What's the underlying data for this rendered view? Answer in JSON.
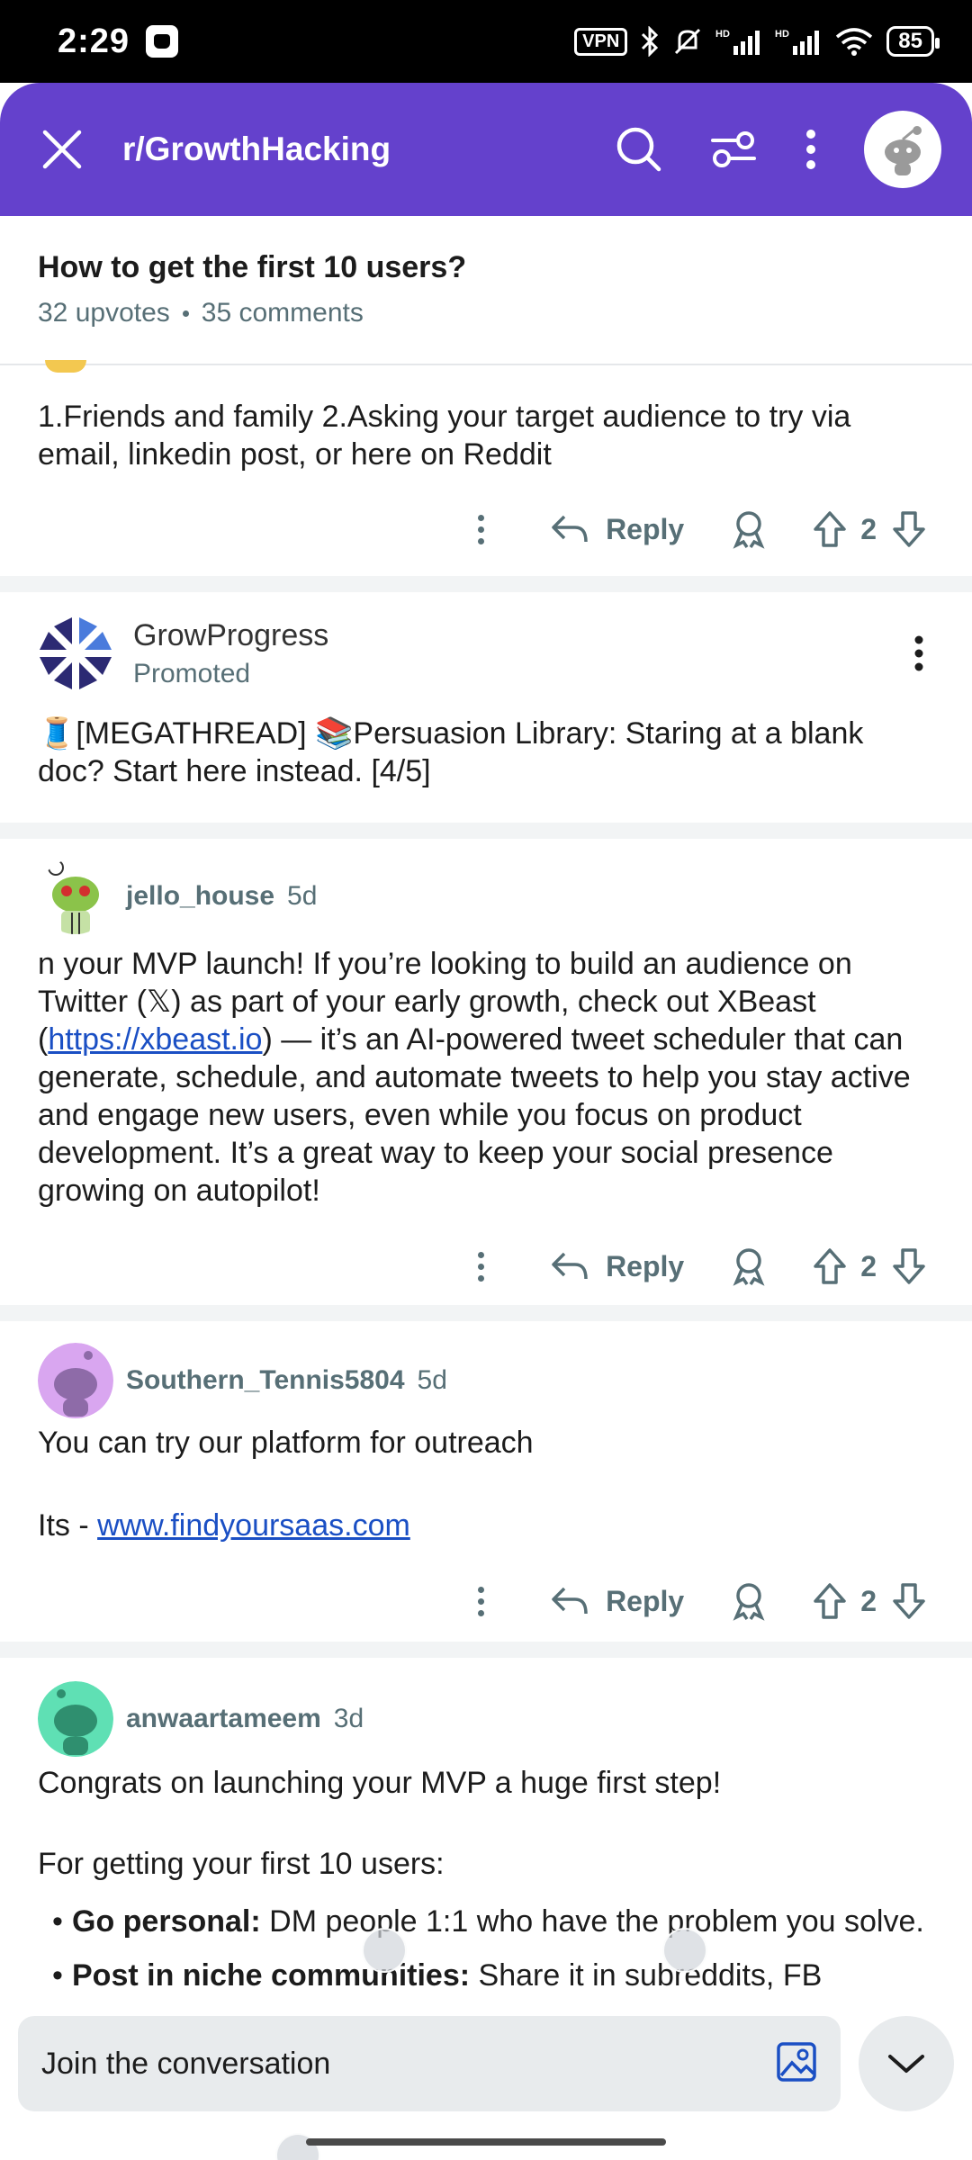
{
  "status_bar": {
    "time": "2:29",
    "vpn": "VPN",
    "battery": "85"
  },
  "header": {
    "subreddit": "r/GrowthHacking"
  },
  "post": {
    "title": "How to get the first 10 users?",
    "upvotes": "32 upvotes",
    "comments": "35 comments"
  },
  "comment1": {
    "text": "1.Friends and family 2.Asking your target audience to try via email, linkedin post, or here on Reddit",
    "reply_label": "Reply",
    "votes": "2"
  },
  "promoted": {
    "advertiser": "GrowProgress",
    "label": "Promoted",
    "text": "🧵[MEGATHREAD] 📚Persuasion Library: Staring at a blank doc? Start here instead. [4/5]"
  },
  "comment2": {
    "user": "jello_house",
    "time": "5d",
    "text_before_link": "n your MVP launch! If you’re looking to build an audience on Twitter (𝕏) as part of your early growth, check out XBeast (",
    "link": "https://xbeast.io",
    "text_after_link": ") — it’s an AI-powered tweet scheduler that can generate, schedule, and automate tweets to help you stay active and engage new users, even while you focus on product development. It’s a great way to keep your social presence growing on autopilot!",
    "reply_label": "Reply",
    "votes": "2"
  },
  "comment3": {
    "user": "Southern_Tennis5804",
    "time": "5d",
    "line1": "You can try our platform for outreach",
    "line2_prefix": "Its - ",
    "link": "www.findyoursaas.com",
    "reply_label": "Reply",
    "votes": "2"
  },
  "comment4": {
    "user": "anwaartameem",
    "time": "3d",
    "line1": "Congrats on launching your MVP a huge first step!",
    "line2": "For getting your first 10 users:",
    "bullets": [
      {
        "bold": "Go personal:",
        "text": " DM people 1:1 who have the problem you solve."
      },
      {
        "bold": "Post in niche communities:",
        "text": " Share it in subreddits, FB"
      }
    ]
  },
  "bottom": {
    "placeholder": "Join the conversation"
  }
}
